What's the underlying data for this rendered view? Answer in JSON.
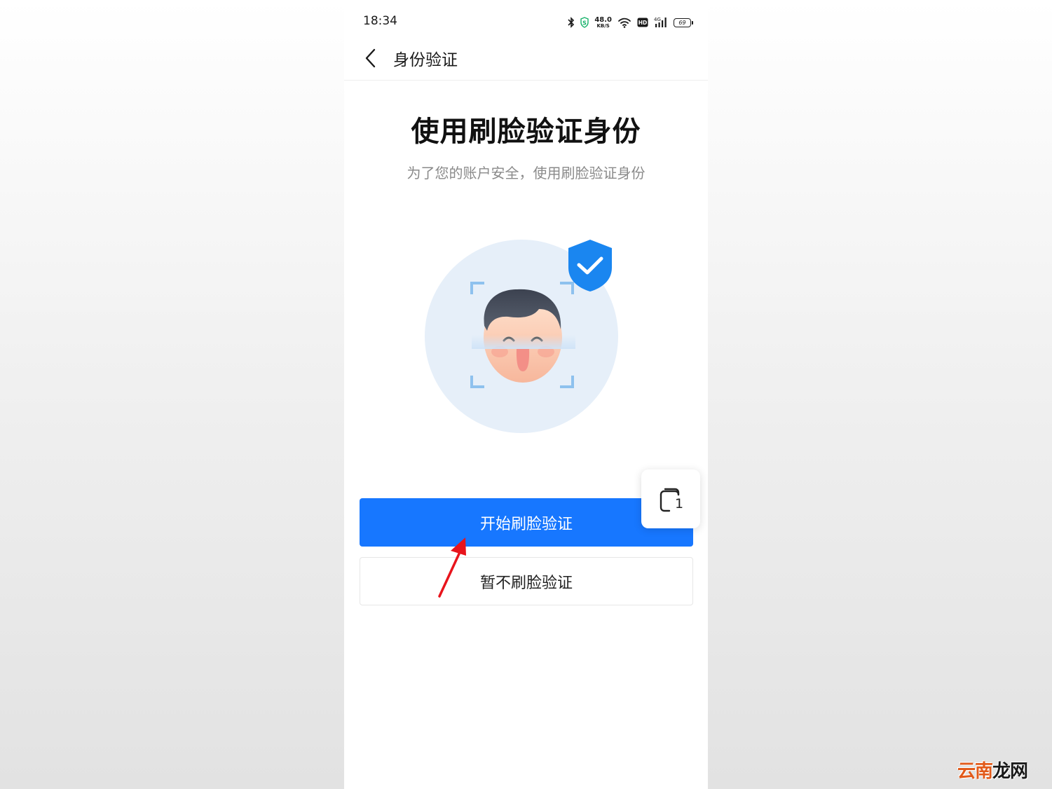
{
  "status_bar": {
    "time": "18:34",
    "net_speed_value": "48.0",
    "net_speed_unit": "KB/S",
    "battery_level": "69",
    "icons": [
      "bluetooth-icon",
      "shield-s-icon",
      "wifi-icon",
      "hd-icon",
      "signal-4g-icon",
      "battery-icon"
    ]
  },
  "nav": {
    "title": "身份验证",
    "back_icon": "chevron-left-icon"
  },
  "main": {
    "title": "使用刷脸验证身份",
    "subtitle": "为了您的账户安全，使用刷脸验证身份"
  },
  "floating": {
    "icon": "multi-window-icon",
    "count": "1"
  },
  "buttons": {
    "primary": "开始刷脸验证",
    "secondary": "暂不刷脸验证"
  },
  "watermark": {
    "part1": "云南",
    "part2": "龙网"
  },
  "colors": {
    "accent": "#1777ff",
    "shield": "#1a86f0",
    "annotation": "#e8141c"
  }
}
